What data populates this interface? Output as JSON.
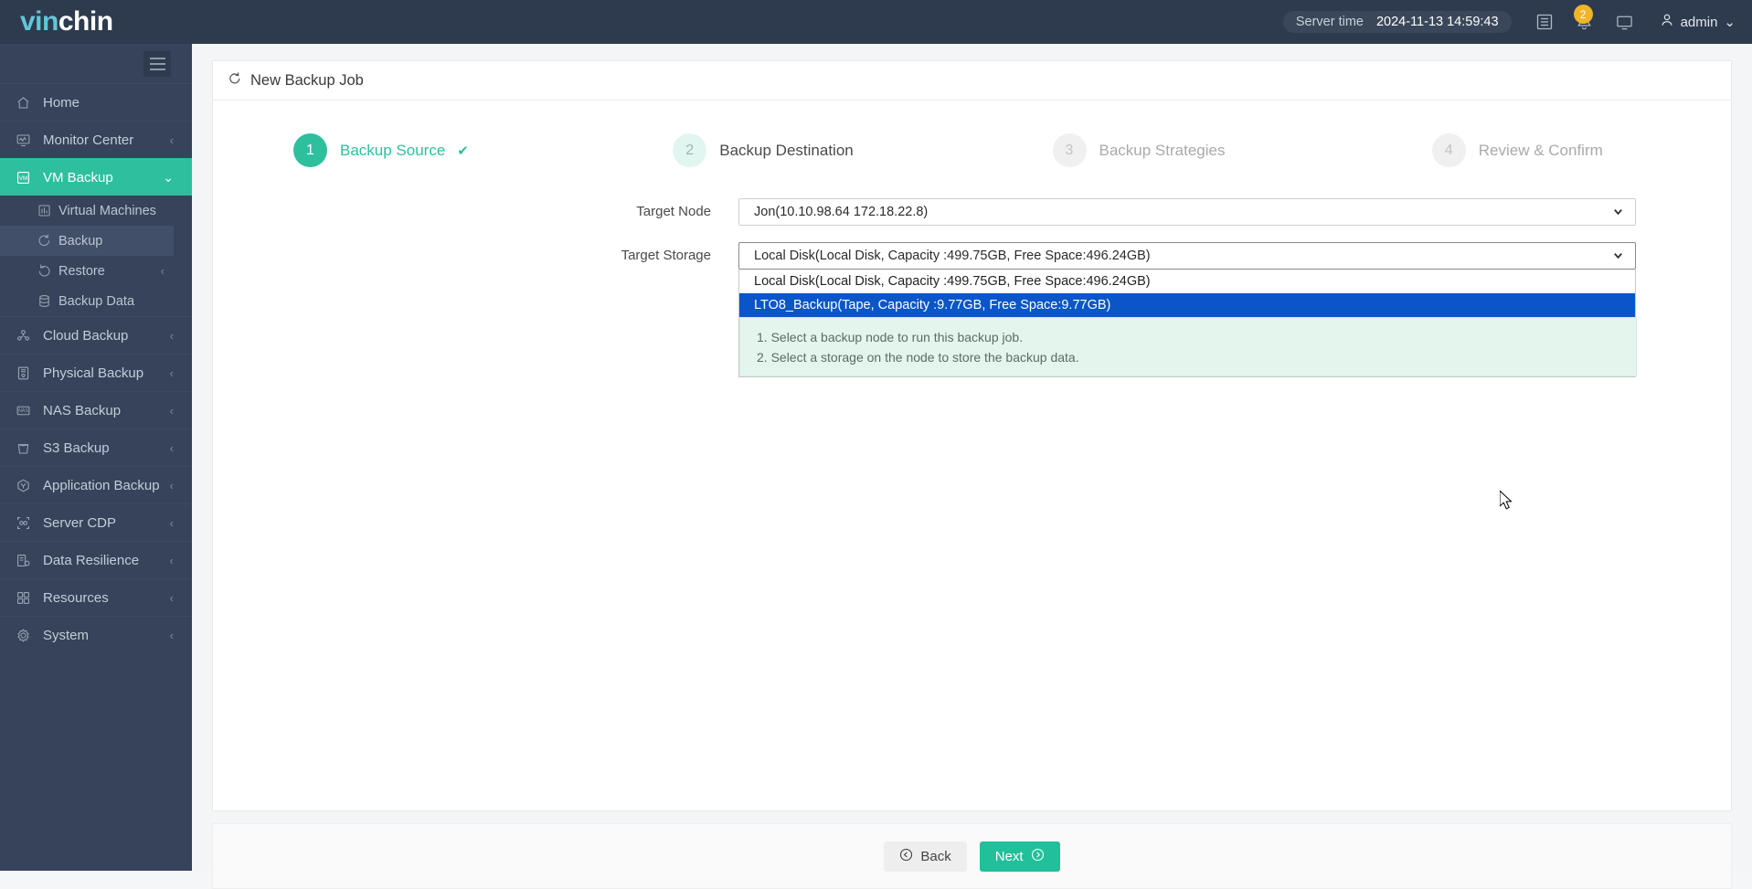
{
  "header": {
    "logo_part1": "vin",
    "logo_part2": "chin",
    "server_time_label": "Server time",
    "server_time_value": "2024-11-13 14:59:43",
    "notification_count": "2",
    "user_name": "admin",
    "icons": [
      "list-icon",
      "bell-icon",
      "monitor-icon",
      "user-icon"
    ]
  },
  "sidebar": {
    "items": [
      {
        "label": "Home",
        "icon": "home-icon",
        "chevron": "",
        "active": false
      },
      {
        "label": "Monitor Center",
        "icon": "monitor-icon",
        "chevron": "‹",
        "active": false
      },
      {
        "label": "VM Backup",
        "icon": "vm-icon",
        "chevron": "⌄",
        "active": true
      },
      {
        "label": "Cloud Backup",
        "icon": "cloud-icon",
        "chevron": "‹",
        "active": false
      },
      {
        "label": "Physical Backup",
        "icon": "server-icon",
        "chevron": "‹",
        "active": false
      },
      {
        "label": "NAS Backup",
        "icon": "nas-icon",
        "chevron": "‹",
        "active": false
      },
      {
        "label": "S3 Backup",
        "icon": "bucket-icon",
        "chevron": "‹",
        "active": false
      },
      {
        "label": "Application Backup",
        "icon": "hexagon-icon",
        "chevron": "‹",
        "active": false
      },
      {
        "label": "Server CDP",
        "icon": "cdp-icon",
        "chevron": "‹",
        "active": false
      },
      {
        "label": "Data Resilience",
        "icon": "resilience-icon",
        "chevron": "‹",
        "active": false
      },
      {
        "label": "Resources",
        "icon": "grid-icon",
        "chevron": "‹",
        "active": false
      },
      {
        "label": "System",
        "icon": "gear-icon",
        "chevron": "‹",
        "active": false
      }
    ],
    "subitems": [
      {
        "label": "Virtual Machines",
        "icon": "chart-icon",
        "chevron": "",
        "selected": false
      },
      {
        "label": "Backup",
        "icon": "refresh-icon",
        "chevron": "",
        "selected": true
      },
      {
        "label": "Restore",
        "icon": "restore-icon",
        "chevron": "‹",
        "selected": false
      },
      {
        "label": "Backup Data",
        "icon": "database-icon",
        "chevron": "",
        "selected": false
      }
    ]
  },
  "page": {
    "title": "New Backup Job",
    "title_icon": "refresh-icon"
  },
  "steps": [
    {
      "num": "1",
      "label": "Backup Source",
      "state": "done",
      "check": "✔"
    },
    {
      "num": "2",
      "label": "Backup Destination",
      "state": "next",
      "check": ""
    },
    {
      "num": "3",
      "label": "Backup Strategies",
      "state": "idle",
      "check": ""
    },
    {
      "num": "4",
      "label": "Review & Confirm",
      "state": "idle",
      "check": ""
    }
  ],
  "form": {
    "target_node_label": "Target Node",
    "target_node_value": "Jon(10.10.98.64 172.18.22.8)",
    "target_storage_label": "Target Storage",
    "target_storage_value": "Local Disk(Local Disk, Capacity :499.75GB, Free Space:496.24GB)",
    "storage_options": [
      {
        "label": "Local Disk(Local Disk, Capacity :499.75GB, Free Space:496.24GB)",
        "highlighted": false
      },
      {
        "label": "LTO8_Backup(Tape, Capacity :9.77GB, Free Space:9.77GB)",
        "highlighted": true
      }
    ],
    "hints": [
      "1. Select a backup node to run this backup job.",
      "2. Select a storage on the node to store the backup data."
    ]
  },
  "footer": {
    "back_label": "Back",
    "next_label": "Next"
  },
  "colors": {
    "accent": "#2ec09e",
    "sidebar_bg": "#36435a",
    "header_bg": "#2e3b4e",
    "highlight_blue": "#0a56c8",
    "badge_amber": "#f0b429",
    "hint_bg": "#e4f5ee"
  }
}
